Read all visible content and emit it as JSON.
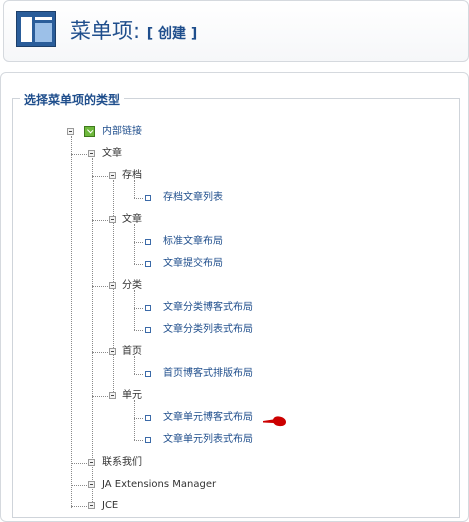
{
  "header": {
    "title": "菜单项:",
    "subtitle": "[ 创建 ]",
    "logo_icon": "menu-manager-icon"
  },
  "section": {
    "legend": "选择菜单项的类型"
  },
  "tree": {
    "root": "内部链接",
    "articles": "文章",
    "archive": "存档",
    "archive_list": "存档文章列表",
    "article": "文章",
    "article_standard": "标准文章布局",
    "article_submit": "文章提交布局",
    "category": "分类",
    "category_blog": "文章分类博客式布局",
    "category_list": "文章分类列表式布局",
    "frontpage": "首页",
    "frontpage_blog": "首页博客式排版布局",
    "section": "单元",
    "section_blog": "文章单元博客式布局",
    "section_list": "文章单元列表式布局",
    "contact": "联系我们",
    "ja_extensions": "JA Extensions Manager",
    "jce": "JCE"
  },
  "colors": {
    "accent": "#1f4e8c",
    "pointer": "#cc0000"
  }
}
